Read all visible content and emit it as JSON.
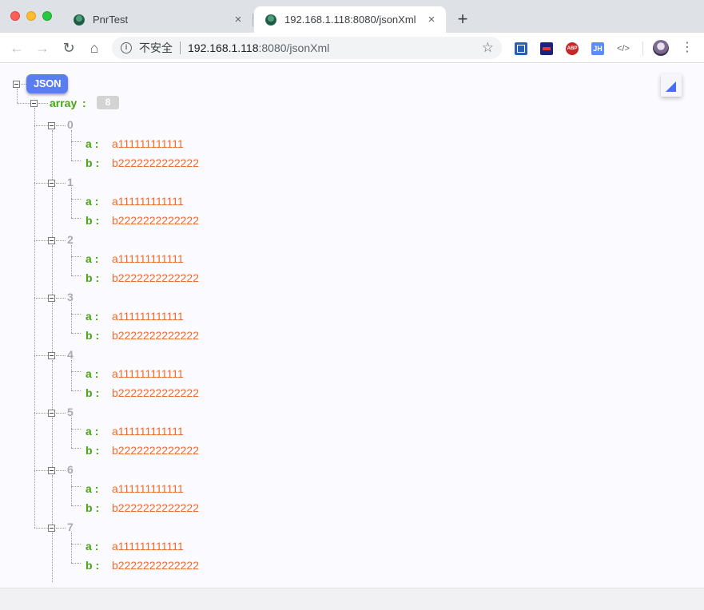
{
  "browser": {
    "tabs": [
      {
        "title": "PnrTest",
        "close": "×"
      },
      {
        "title": "192.168.1.118:8080/jsonXml",
        "close": "×"
      }
    ],
    "new_tab": "+",
    "security_label": "不安全",
    "url_host": "192.168.1.118",
    "url_rest": ":8080/jsonXml",
    "extensions": [
      "",
      "",
      "ABP",
      "JH",
      "</>"
    ]
  },
  "viewer": {
    "root_label": "JSON",
    "array_key": "array",
    "colon": ":",
    "array_count": "8",
    "items": [
      {
        "index": "0",
        "a": "a111111111111",
        "b": "b2222222222222"
      },
      {
        "index": "1",
        "a": "a111111111111",
        "b": "b2222222222222"
      },
      {
        "index": "2",
        "a": "a111111111111",
        "b": "b2222222222222"
      },
      {
        "index": "3",
        "a": "a111111111111",
        "b": "b2222222222222"
      },
      {
        "index": "4",
        "a": "a111111111111",
        "b": "b2222222222222"
      },
      {
        "index": "5",
        "a": "a111111111111",
        "b": "b2222222222222"
      },
      {
        "index": "6",
        "a": "a111111111111",
        "b": "b2222222222222"
      },
      {
        "index": "7",
        "a": "a111111111111",
        "b": "b2222222222222"
      }
    ],
    "field_a": "a",
    "field_b": "b"
  }
}
